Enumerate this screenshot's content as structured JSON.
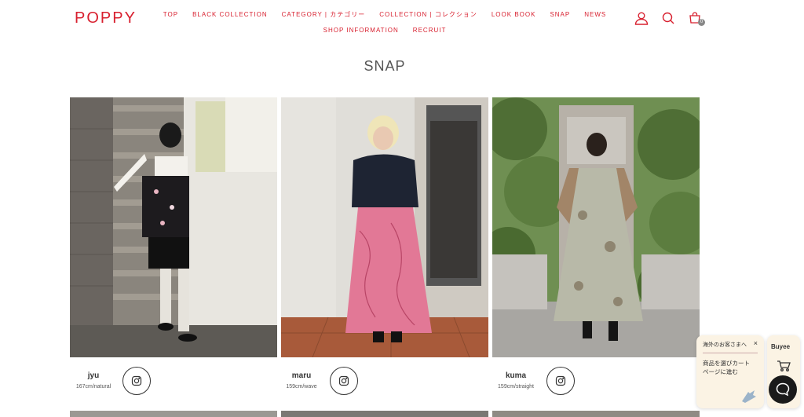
{
  "brand": {
    "logo": "POPPY",
    "accent": "#d8202f"
  },
  "nav": {
    "row1": [
      "TOP",
      "BLACK COLLECTION",
      "CATEGORY | カテゴリー",
      "COLLECTION | コレクション",
      "LOOK BOOK",
      "SNAP",
      "NEWS"
    ],
    "row2": [
      "SHOP INFORMATION",
      "RECRUIT"
    ]
  },
  "header_icons": [
    "user-icon",
    "search-icon",
    "cart-icon"
  ],
  "cart_count": "0",
  "page": {
    "title": "SNAP"
  },
  "snaps": [
    {
      "name": "jyu",
      "info": "167cm/natural"
    },
    {
      "name": "maru",
      "info": "159cm/wave"
    },
    {
      "name": "kuma",
      "info": "159cm/straight"
    }
  ],
  "buyee": {
    "header": "海外のお客さまへ",
    "message_line1": "商品を選びカート",
    "message_line2": "ページに進む",
    "logo": "Buyee"
  }
}
